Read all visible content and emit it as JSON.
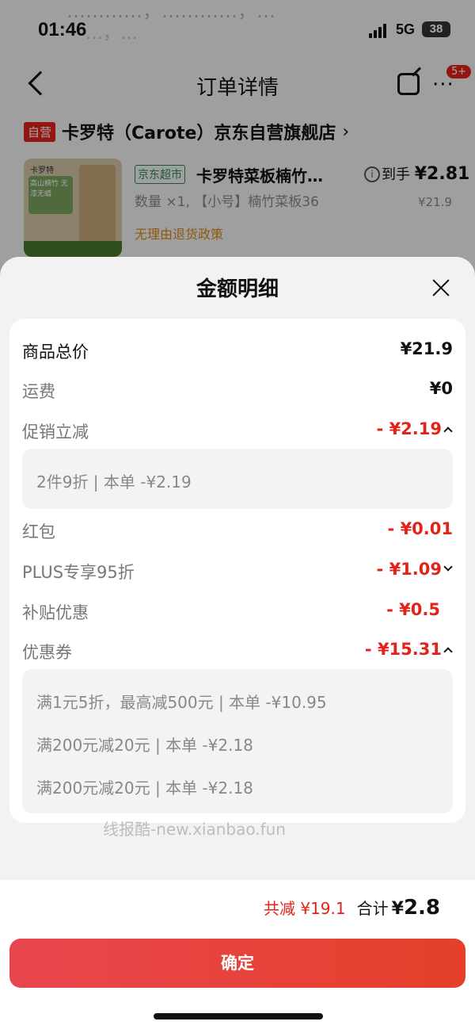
{
  "status": {
    "time": "01:46",
    "network": "5G",
    "battery": "38"
  },
  "background": {
    "ghost_line1": "…………，…………，…",
    "ghost_line2": "…，…",
    "nav_title": "订单详情",
    "more_badge": "5+",
    "store_tag": "自营",
    "store_name": "卡罗特（Carote）京东自营旗舰店",
    "store_chevron": "›",
    "product": {
      "channel_tag": "京东超市",
      "title": "卡罗特菜板楠竹…",
      "final_price_prefix": "到手",
      "final_price": "¥2.81",
      "spec": "数量 ×1, 【小号】楠竹菜板36",
      "price": "¥21.9",
      "policy": "无理由退货政策",
      "image_brand": "卡罗特",
      "image_promo": "高山楠竹 无漆无蜡"
    }
  },
  "sheet": {
    "title": "金额明细",
    "rows": [
      {
        "label": "商品总价",
        "value": "¥21.9"
      },
      {
        "label": "运费",
        "value": "¥0"
      },
      {
        "label": "促销立减",
        "value": "- ¥2.19"
      },
      {
        "label": "红包",
        "value": "- ¥0.01"
      },
      {
        "label": "PLUS专享95折",
        "value": "- ¥1.09"
      },
      {
        "label": "补贴优惠",
        "value": "- ¥0.5"
      },
      {
        "label": "优惠券",
        "value": "- ¥15.31"
      }
    ],
    "promo_details": [
      "2件9折 | 本单 -¥2.19"
    ],
    "coupon_details": [
      "满1元5折，最高减500元 | 本单 -¥10.95",
      "满200元减20元 | 本单 -¥2.18",
      "满200元减20元 | 本单 -¥2.18"
    ],
    "watermark": "线报酷-new.xianbao.fun"
  },
  "footer": {
    "saved": "共减 ¥19.1",
    "total_label": "合计",
    "total_currency": "¥",
    "total_value": "2.8",
    "confirm": "确定"
  },
  "colors": {
    "accent_red": "#e2231a",
    "button_start": "#e8464f",
    "button_end": "#e5402a"
  }
}
